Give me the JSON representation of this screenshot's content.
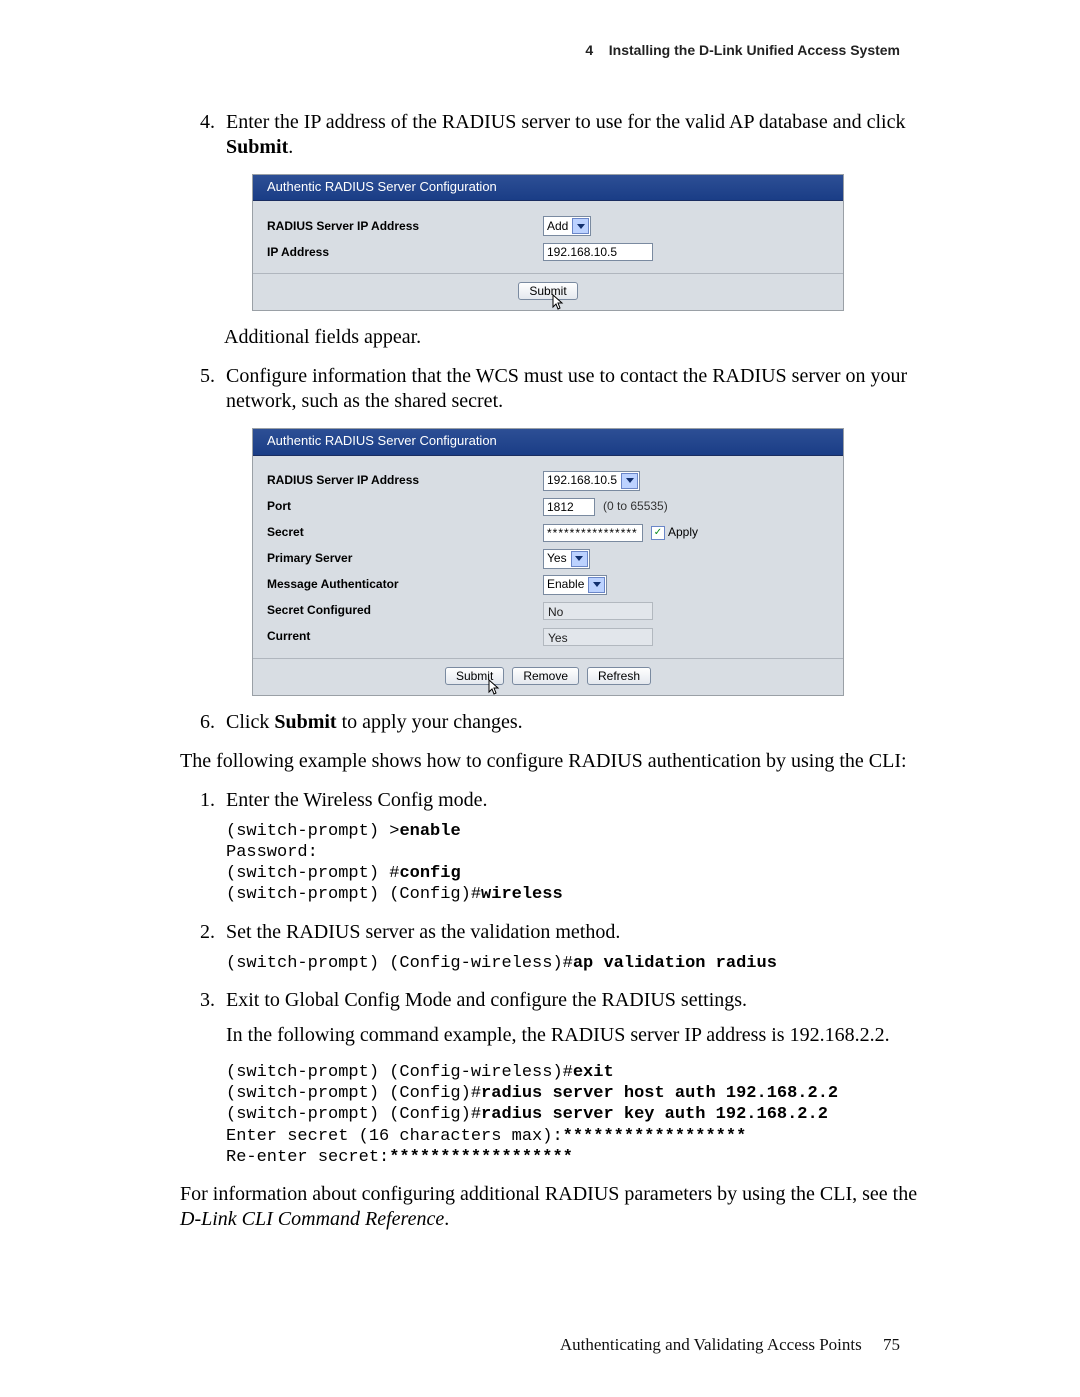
{
  "header": {
    "chapter_num": "4",
    "chapter_title": "Installing the D-Link Unified Access System"
  },
  "steps456": {
    "n4": "4.",
    "n5": "5.",
    "n6": "6.",
    "s4_text_a": "Enter the IP address of the RADIUS server to use for the valid AP database and click ",
    "s4_bold": "Submit",
    "s4_text_b": ".",
    "after_panel1": "Additional fields appear.",
    "s5_text": "Configure information that the WCS must use to contact the RADIUS server on your network, such as the shared secret.",
    "s6_text_a": "Click ",
    "s6_bold": "Submit",
    "s6_text_b": " to apply your changes."
  },
  "panel1": {
    "title": "Authentic RADIUS Server Configuration",
    "label_ipmode": "RADIUS Server IP Address",
    "ipmode_select": "Add",
    "label_ip": "IP Address",
    "ip_value": "192.168.10.5",
    "btn_submit": "Submit"
  },
  "panel2": {
    "title": "Authentic RADIUS Server Configuration",
    "label_ipsel": "RADIUS Server IP Address",
    "ipsel_value": "192.168.10.5",
    "label_port": "Port",
    "port_value": "1812",
    "port_range": "(0 to 65535)",
    "label_secret": "Secret",
    "secret_value": "****************",
    "apply_label": "Apply",
    "label_primary": "Primary Server",
    "primary_value": "Yes",
    "label_msgauth": "Message Authenticator",
    "msgauth_value": "Enable",
    "label_secconf": "Secret Configured",
    "secconf_value": "No",
    "label_current": "Current",
    "current_value": "Yes",
    "btn_submit": "Submit",
    "btn_remove": "Remove",
    "btn_refresh": "Refresh"
  },
  "bridge": {
    "cli_intro": "The following example shows how to configure RADIUS authentication by using the CLI:"
  },
  "cli": {
    "c1_num": "1.",
    "c1_text": "Enter the Wireless Config mode.",
    "c1_line1_plain": "(switch-prompt) >",
    "c1_line1_bold": "enable",
    "c1_line2": "Password:",
    "c1_line3_plain": "(switch-prompt) #",
    "c1_line3_bold": "config",
    "c1_line4_plain": "(switch-prompt) (Config)#",
    "c1_line4_bold": "wireless",
    "c2_num": "2.",
    "c2_text": "Set the RADIUS server as the validation method.",
    "c2_line1_plain": "(switch-prompt) (Config-wireless)#",
    "c2_line1_bold": "ap validation radius",
    "c3_num": "3.",
    "c3_text": "Exit to Global Config Mode and configure the RADIUS settings.",
    "c3_para": "In the following command example, the RADIUS server IP address is 192.168.2.2.",
    "c3_line1_plain": "(switch-prompt) (Config-wireless)#",
    "c3_line1_bold": "exit",
    "c3_line2_plain": "(switch-prompt) (Config)#",
    "c3_line2_bold": "radius server host auth 192.168.2.2",
    "c3_line3_plain": "(switch-prompt) (Config)#",
    "c3_line3_bold": "radius server key auth 192.168.2.2",
    "c3_line4_plain": "Enter secret (16 characters max):",
    "c3_line4_bold": "******************",
    "c3_line5_plain": "Re-enter secret:",
    "c3_line5_bold": "******************"
  },
  "closing": {
    "text_a": "For information about configuring additional RADIUS parameters by using the CLI, see the ",
    "ref": "D-Link CLI Command Reference",
    "text_b": "."
  },
  "footer": {
    "section": "Authenticating and Validating Access Points",
    "page": "75"
  }
}
